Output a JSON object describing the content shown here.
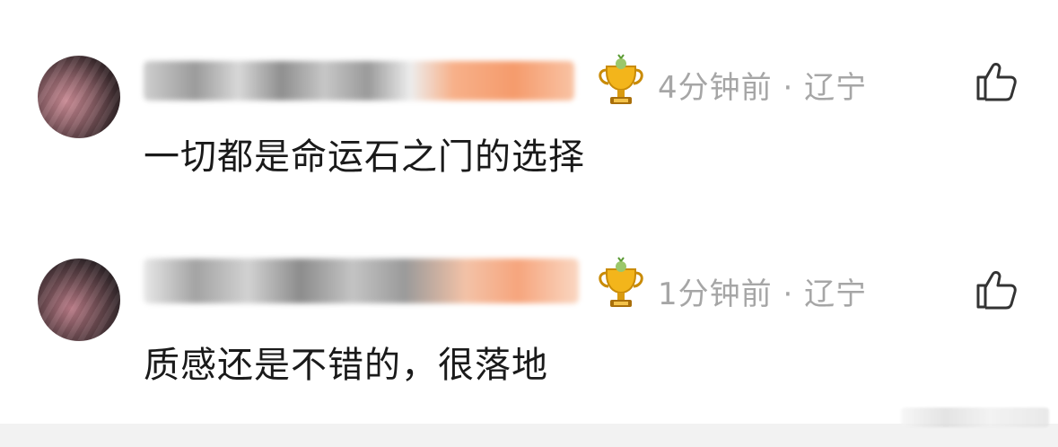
{
  "comments": [
    {
      "time": "4分钟前",
      "sep": " · ",
      "location": "辽宁",
      "text": "一切都是命运石之门的选择"
    },
    {
      "time": "1分钟前",
      "sep": " · ",
      "location": "辽宁",
      "text": "质感还是不错的，很落地"
    }
  ],
  "icons": {
    "badge": "trophy-badge-icon",
    "like": "thumbs-up-icon"
  },
  "colors": {
    "text": "#1a1a1a",
    "meta": "#a6a6a6",
    "username_badge": "#f59b6c"
  }
}
